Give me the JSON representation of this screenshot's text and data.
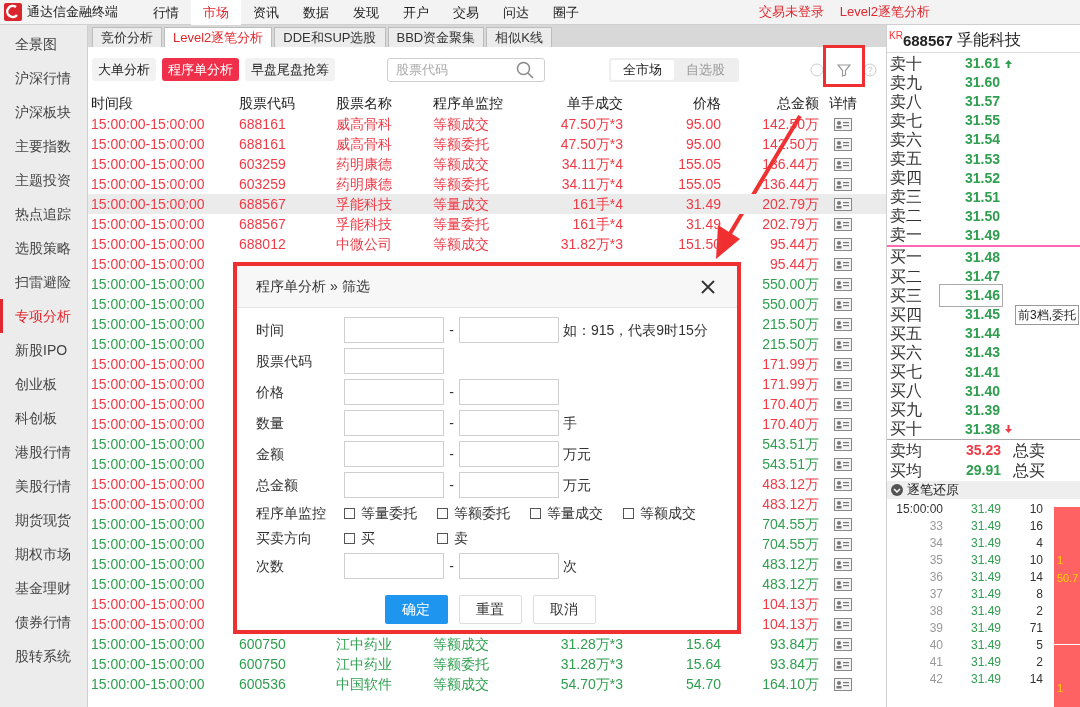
{
  "app": {
    "title": "通达信金融终端"
  },
  "menu": [
    {
      "label": "行情",
      "selected": false
    },
    {
      "label": "市场",
      "selected": true
    },
    {
      "label": "资讯",
      "selected": false
    },
    {
      "label": "数据",
      "selected": false
    },
    {
      "label": "发现",
      "selected": false
    },
    {
      "label": "开户",
      "selected": false
    },
    {
      "label": "交易",
      "selected": false
    },
    {
      "label": "问达",
      "selected": false
    },
    {
      "label": "圈子",
      "selected": false
    }
  ],
  "status_links": [
    "交易未登录",
    "Level2逐笔分析"
  ],
  "sidebar": [
    {
      "label": "全景图",
      "selected": false
    },
    {
      "label": "沪深行情",
      "selected": false
    },
    {
      "label": "沪深板块",
      "selected": false
    },
    {
      "label": "主要指数",
      "selected": false
    },
    {
      "label": "主题投资",
      "selected": false
    },
    {
      "label": "热点追踪",
      "selected": false
    },
    {
      "label": "选股策略",
      "selected": false
    },
    {
      "label": "扫雷避险",
      "selected": false
    },
    {
      "label": "专项分析",
      "selected": true
    },
    {
      "label": "新股IPO",
      "selected": false
    },
    {
      "label": "创业板",
      "selected": false
    },
    {
      "label": "科创板",
      "selected": false
    },
    {
      "label": "港股行情",
      "selected": false
    },
    {
      "label": "美股行情",
      "selected": false
    },
    {
      "label": "期货现货",
      "selected": false
    },
    {
      "label": "期权市场",
      "selected": false
    },
    {
      "label": "基金理财",
      "selected": false
    },
    {
      "label": "债券行情",
      "selected": false
    },
    {
      "label": "股转系统",
      "selected": false
    }
  ],
  "tabs": [
    {
      "label": "竞价分析",
      "selected": false
    },
    {
      "label": "Level2逐笔分析",
      "selected": true
    },
    {
      "label": "DDE和SUP选股",
      "selected": false
    },
    {
      "label": "BBD资金聚集",
      "selected": false
    },
    {
      "label": "相似K线",
      "selected": false
    }
  ],
  "subtabs": [
    {
      "label": "大单分析",
      "selected": false
    },
    {
      "label": "程序单分析",
      "selected": true
    },
    {
      "label": "早盘尾盘抢筹",
      "selected": false
    }
  ],
  "search": {
    "placeholder": "股票代码"
  },
  "scope": [
    {
      "label": "全市场",
      "selected": true
    },
    {
      "label": "自选股",
      "selected": false
    }
  ],
  "table": {
    "columns": [
      "时间段",
      "股票代码",
      "股票名称",
      "程序单监控",
      "单手成交",
      "价格",
      "总金额",
      "详情"
    ],
    "rows": [
      {
        "color": "#ee3b46",
        "selected": false,
        "time": "15:00:00-15:00:00",
        "code": "688161",
        "name": "威高骨科",
        "monitor": "等额成交",
        "lot": "47.50万*3",
        "price": "95.00",
        "total": "142.50万"
      },
      {
        "color": "#ee3b46",
        "selected": false,
        "time": "15:00:00-15:00:00",
        "code": "688161",
        "name": "威高骨科",
        "monitor": "等额委托",
        "lot": "47.50万*3",
        "price": "95.00",
        "total": "142.50万"
      },
      {
        "color": "#ee3b46",
        "selected": false,
        "time": "15:00:00-15:00:00",
        "code": "603259",
        "name": "药明康德",
        "monitor": "等额成交",
        "lot": "34.11万*4",
        "price": "155.05",
        "total": "136.44万"
      },
      {
        "color": "#ee3b46",
        "selected": false,
        "time": "15:00:00-15:00:00",
        "code": "603259",
        "name": "药明康德",
        "monitor": "等额委托",
        "lot": "34.11万*4",
        "price": "155.05",
        "total": "136.44万"
      },
      {
        "color": "#ee3b46",
        "selected": true,
        "time": "15:00:00-15:00:00",
        "code": "688567",
        "name": "孚能科技",
        "monitor": "等量成交",
        "lot": "161手*4",
        "price": "31.49",
        "total": "202.79万"
      },
      {
        "color": "#ee3b46",
        "selected": false,
        "time": "15:00:00-15:00:00",
        "code": "688567",
        "name": "孚能科技",
        "monitor": "等量委托",
        "lot": "161手*4",
        "price": "31.49",
        "total": "202.79万"
      },
      {
        "color": "#ee3b46",
        "selected": false,
        "time": "15:00:00-15:00:00",
        "code": "688012",
        "name": "中微公司",
        "monitor": "等额成交",
        "lot": "31.82万*3",
        "price": "151.50",
        "total": "95.44万"
      },
      {
        "color": "#ee3b46",
        "selected": false,
        "time": "15:00:00-15:00:00",
        "total": "95.44万"
      },
      {
        "color": "#2f9e4f",
        "selected": false,
        "time": "15:00:00-15:00:00",
        "total": "550.00万"
      },
      {
        "color": "#2f9e4f",
        "selected": false,
        "time": "15:00:00-15:00:00",
        "total": "550.00万"
      },
      {
        "color": "#2f9e4f",
        "selected": false,
        "time": "15:00:00-15:00:00",
        "total": "215.50万"
      },
      {
        "color": "#2f9e4f",
        "selected": false,
        "time": "15:00:00-15:00:00",
        "total": "215.50万"
      },
      {
        "color": "#ee3b46",
        "selected": false,
        "time": "15:00:00-15:00:00",
        "total": "171.99万"
      },
      {
        "color": "#ee3b46",
        "selected": false,
        "time": "15:00:00-15:00:00",
        "total": "171.99万"
      },
      {
        "color": "#ee3b46",
        "selected": false,
        "time": "15:00:00-15:00:00",
        "total": "170.40万"
      },
      {
        "color": "#ee3b46",
        "selected": false,
        "time": "15:00:00-15:00:00",
        "total": "170.40万"
      },
      {
        "color": "#2f9e4f",
        "selected": false,
        "time": "15:00:00-15:00:00",
        "total": "543.51万"
      },
      {
        "color": "#2f9e4f",
        "selected": false,
        "time": "15:00:00-15:00:00",
        "total": "543.51万"
      },
      {
        "color": "#ee3b46",
        "selected": false,
        "time": "15:00:00-15:00:00",
        "total": "483.12万"
      },
      {
        "color": "#ee3b46",
        "selected": false,
        "time": "15:00:00-15:00:00",
        "total": "483.12万"
      },
      {
        "color": "#2f9e4f",
        "selected": false,
        "time": "15:00:00-15:00:00",
        "total": "704.55万"
      },
      {
        "color": "#2f9e4f",
        "selected": false,
        "time": "15:00:00-15:00:00",
        "total": "704.55万"
      },
      {
        "color": "#2f9e4f",
        "selected": false,
        "time": "15:00:00-15:00:00",
        "total": "483.12万"
      },
      {
        "color": "#2f9e4f",
        "selected": false,
        "time": "15:00:00-15:00:00",
        "total": "483.12万"
      },
      {
        "color": "#ee3b46",
        "selected": false,
        "time": "15:00:00-15:00:00",
        "total": "104.13万"
      },
      {
        "color": "#ee3b46",
        "selected": false,
        "time": "15:00:00-15:00:00",
        "total": "104.13万"
      },
      {
        "color": "#2f9e4f",
        "selected": false,
        "time": "15:00:00-15:00:00",
        "code": "600750",
        "name": "江中药业",
        "monitor": "等额成交",
        "lot": "31.28万*3",
        "price": "15.64",
        "total": "93.84万"
      },
      {
        "color": "#2f9e4f",
        "selected": false,
        "time": "15:00:00-15:00:00",
        "code": "600750",
        "name": "江中药业",
        "monitor": "等额委托",
        "lot": "31.28万*3",
        "price": "15.64",
        "total": "93.84万"
      },
      {
        "color": "#2f9e4f",
        "selected": false,
        "time": "15:00:00-15:00:00",
        "code": "600536",
        "name": "中国软件",
        "monitor": "等额成交",
        "lot": "54.70万*3",
        "price": "54.70",
        "total": "164.10万"
      }
    ]
  },
  "dialog": {
    "title": "程序单分析 » 筛选",
    "fields": [
      {
        "kind": "range",
        "label": "时间",
        "separator": "-",
        "note": "如：915，代表9时15分"
      },
      {
        "kind": "single",
        "label": "股票代码"
      },
      {
        "kind": "range",
        "label": "价格",
        "separator": "-"
      },
      {
        "kind": "range",
        "label": "数量",
        "separator": "-",
        "note": "手"
      },
      {
        "kind": "range",
        "label": "金额",
        "separator": "-",
        "note": "万元"
      },
      {
        "kind": "range",
        "label": "总金额",
        "separator": "-",
        "note": "万元"
      },
      {
        "kind": "checks",
        "label": "程序单监控",
        "options": [
          {
            "label": "等量委托",
            "checked": false
          },
          {
            "label": "等额委托",
            "checked": false
          },
          {
            "label": "等量成交",
            "checked": false
          },
          {
            "label": "等额成交",
            "checked": false
          }
        ]
      },
      {
        "kind": "checks",
        "label": "买卖方向",
        "options": [
          {
            "label": "买",
            "checked": false
          },
          {
            "label": "卖",
            "checked": false
          }
        ]
      },
      {
        "kind": "range",
        "label": "次数",
        "separator": "-",
        "note": "次"
      }
    ],
    "buttons": [
      {
        "label": "确定",
        "primary": true
      },
      {
        "label": "重置",
        "primary": false
      },
      {
        "label": "取消",
        "primary": false
      }
    ]
  },
  "quote": {
    "badge": "KR",
    "code": "688567",
    "name": "孚能科技",
    "asks": [
      {
        "label": "卖十",
        "price": "31.61",
        "kind": "up",
        "selected": false
      },
      {
        "label": "卖九",
        "price": "31.60",
        "selected": false
      },
      {
        "label": "卖八",
        "price": "31.57",
        "selected": false
      },
      {
        "label": "卖七",
        "price": "31.55",
        "selected": false
      },
      {
        "label": "卖六",
        "price": "31.54",
        "selected": false
      },
      {
        "label": "卖五",
        "price": "31.53",
        "selected": false
      },
      {
        "label": "卖四",
        "price": "31.52",
        "selected": false
      },
      {
        "label": "卖三",
        "price": "31.51",
        "selected": false
      },
      {
        "label": "卖二",
        "price": "31.50",
        "selected": false
      },
      {
        "label": "卖一",
        "price": "31.49",
        "selected": false
      }
    ],
    "bids": [
      {
        "label": "买一",
        "price": "31.48",
        "selected": false
      },
      {
        "label": "买二",
        "price": "31.47",
        "selected": false
      },
      {
        "label": "买三",
        "price": "31.46",
        "selected": true
      },
      {
        "label": "买四",
        "price": "31.45",
        "selected": false
      },
      {
        "label": "买五",
        "price": "31.44",
        "selected": false
      },
      {
        "label": "买六",
        "price": "31.43",
        "selected": false
      },
      {
        "label": "买七",
        "price": "31.41",
        "selected": false
      },
      {
        "label": "买八",
        "price": "31.40",
        "selected": false
      },
      {
        "label": "买九",
        "price": "31.39",
        "selected": false
      },
      {
        "label": "买十",
        "price": "31.38",
        "kind": "down",
        "selected": false
      }
    ],
    "tooltip": "前3档,委托",
    "summary": [
      {
        "label": "卖均",
        "value": "35.23",
        "color": "#ee3b46",
        "note": "总卖"
      },
      {
        "label": "买均",
        "value": "29.91",
        "color": "#2f9e4f",
        "note": "总买"
      }
    ]
  },
  "ticks": {
    "title": "逐笔还原",
    "rows": [
      {
        "kind": "full",
        "time": "15:00:00",
        "price": "31.49",
        "volume": "10"
      },
      {
        "kind": "seconds",
        "time": "33",
        "price": "31.49",
        "volume": "16"
      },
      {
        "kind": "seconds",
        "time": "34",
        "price": "31.49",
        "volume": "4"
      },
      {
        "kind": "seconds",
        "time": "35",
        "price": "31.49",
        "volume": "10"
      },
      {
        "kind": "seconds",
        "time": "36",
        "price": "31.49",
        "volume": "14"
      },
      {
        "kind": "seconds",
        "time": "37",
        "price": "31.49",
        "volume": "8"
      },
      {
        "kind": "seconds",
        "time": "38",
        "price": "31.49",
        "volume": "2"
      },
      {
        "kind": "seconds",
        "time": "39",
        "price": "31.49",
        "volume": "71"
      },
      {
        "kind": "seconds",
        "time": "40",
        "price": "31.49",
        "volume": "5"
      },
      {
        "kind": "seconds",
        "time": "41",
        "price": "31.49",
        "volume": "2"
      },
      {
        "kind": "seconds",
        "time": "42",
        "price": "31.49",
        "volume": "14"
      }
    ],
    "blocks": [
      {
        "lines": [
          "1",
          "50.7"
        ]
      },
      {
        "lines": [
          "1"
        ]
      }
    ]
  }
}
